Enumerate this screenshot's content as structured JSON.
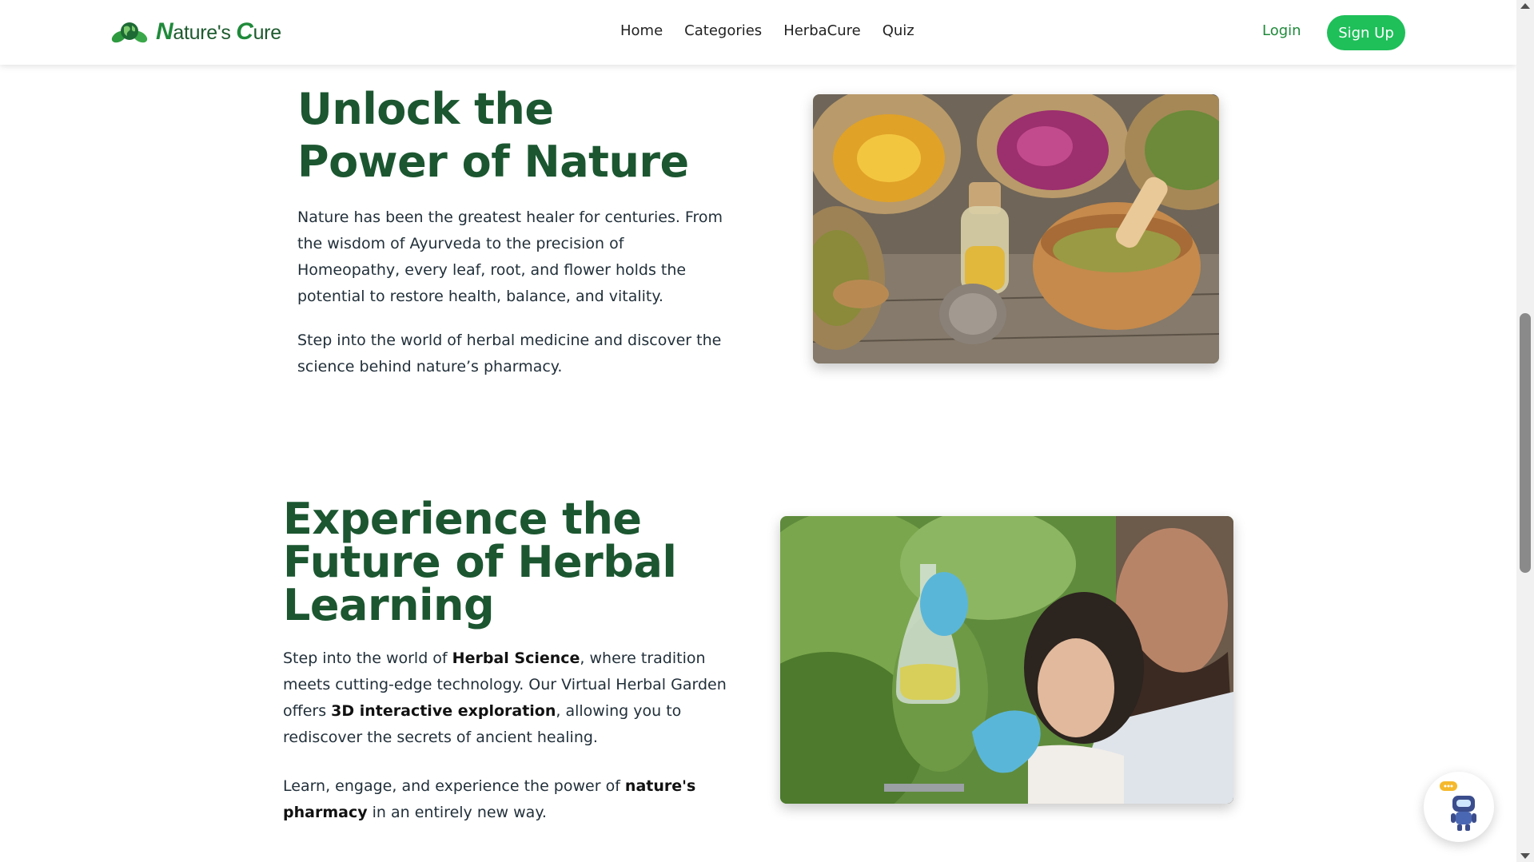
{
  "brand": {
    "name_n": "N",
    "name_rest1": "ature's ",
    "name_c": "C",
    "name_rest2": "ure"
  },
  "nav": {
    "links": [
      "Home",
      "Categories",
      "HerbaCure",
      "Quiz"
    ],
    "login": "Login",
    "signup": "Sign Up"
  },
  "section1": {
    "title": "Unlock the Power of Nature",
    "p1": "Nature has been the greatest healer for centuries. From the wisdom of Ayurveda to the precision of Homeopathy, every leaf, root, and flower holds the potential to restore health, balance, and vitality.",
    "p2": "Step into the world of herbal medicine and discover the science behind nature’s pharmacy."
  },
  "section2": {
    "title": "Experience the Future of Herbal Learning",
    "p1_a": "Step into the world of ",
    "p1_b": "Herbal Science",
    "p1_c": ", where tradition meets cutting-edge technology. Our Virtual Herbal Garden offers ",
    "p1_d": "3D interactive exploration",
    "p1_e": ", allowing you to rediscover the secrets of ancient healing.",
    "p2_a": "Learn, engage, and experience the power of ",
    "p2_b": "nature's pharmacy",
    "p2_c": " in an entirely new way."
  },
  "icons": {
    "logo": "globe-leaf-icon",
    "chatbot": "robot-chat-icon"
  },
  "colors": {
    "heading": "#1b5630",
    "accent": "#1fbf5a",
    "login": "#1f8a3a"
  }
}
